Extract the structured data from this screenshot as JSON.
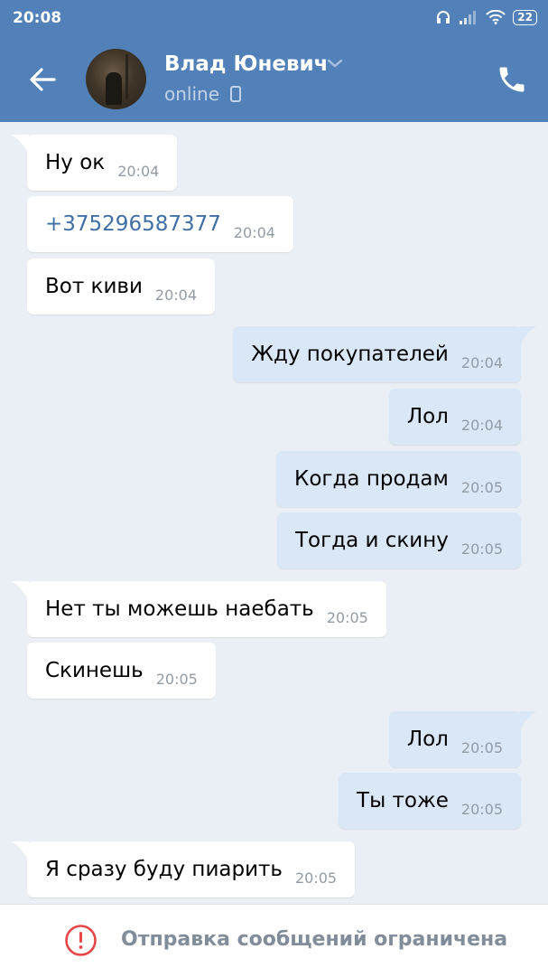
{
  "status_bar": {
    "time": "20:08",
    "battery": "22",
    "icons": [
      "headphones-icon",
      "signal-icon",
      "wifi-icon",
      "battery-icon"
    ]
  },
  "header": {
    "contact_name": "Влад Юневич",
    "status": "online",
    "icons": [
      "back-arrow-icon",
      "chevron-down-icon",
      "mobile-icon",
      "phone-icon"
    ]
  },
  "messages": [
    {
      "direction": "in",
      "text": "Ну ок",
      "time": "20:04"
    },
    {
      "direction": "in",
      "text": "+375296587377",
      "time": "20:04",
      "is_link": true
    },
    {
      "direction": "in",
      "text": "Вот киви",
      "time": "20:04"
    },
    {
      "direction": "out",
      "text": "Жду покупателей",
      "time": "20:04"
    },
    {
      "direction": "out",
      "text": "Лол",
      "time": "20:04"
    },
    {
      "direction": "out",
      "text": "Когда продам",
      "time": "20:05"
    },
    {
      "direction": "out",
      "text": "Тогда и скину",
      "time": "20:05"
    },
    {
      "direction": "in",
      "text": "Нет ты можешь наебать",
      "time": "20:05"
    },
    {
      "direction": "in",
      "text": "Скинешь",
      "time": "20:05"
    },
    {
      "direction": "out",
      "text": "Лол",
      "time": "20:05"
    },
    {
      "direction": "out",
      "text": "Ты тоже",
      "time": "20:05"
    },
    {
      "direction": "in",
      "text": "Я сразу буду пиарить",
      "time": "20:05"
    }
  ],
  "footer": {
    "notice": "Отправка сообщений ограничена",
    "icon": "warning-icon"
  },
  "colors": {
    "header": "#5181b8",
    "background": "#eaeff5",
    "incoming_bubble": "#ffffff",
    "outgoing_bubble": "#d9e7f7",
    "link": "#3f6fa5",
    "warning": "#e64646"
  }
}
